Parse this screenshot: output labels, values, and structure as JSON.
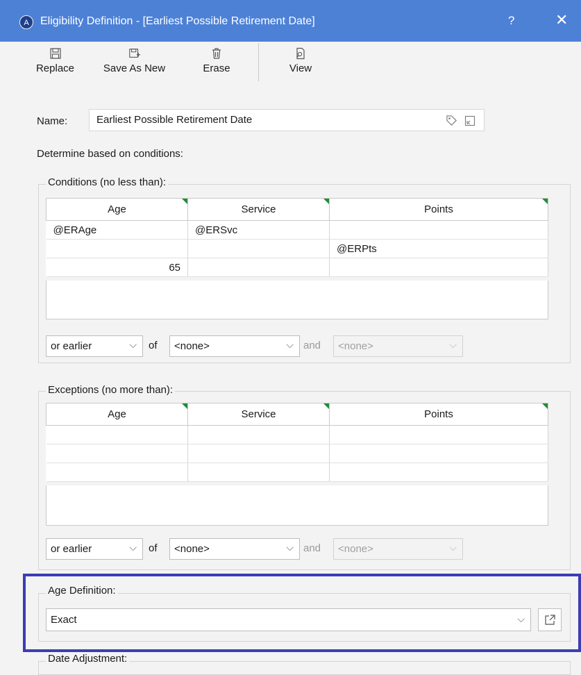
{
  "window": {
    "app_icon_glyph": "A",
    "title": "Eligibility Definition - [Earliest Possible Retirement Date]",
    "help": "?",
    "close": "✕"
  },
  "toolbar": {
    "replace": "Replace",
    "save_as_new": "Save As New",
    "erase": "Erase",
    "view": "View"
  },
  "form": {
    "name_label": "Name:",
    "name_value": "Earliest Possible Retirement Date",
    "determine_label": "Determine based on conditions:"
  },
  "conditions": {
    "title": "Conditions (no less than):",
    "headers": [
      "Age",
      "Service",
      "Points"
    ],
    "rows": [
      [
        "@ERAge",
        "@ERSvc",
        ""
      ],
      [
        "",
        "",
        "@ERPts"
      ],
      [
        "65",
        "",
        ""
      ]
    ],
    "timing_select": "or earlier",
    "of_label": "of",
    "of_select": "<none>",
    "and_label": "and",
    "and_select": "<none>"
  },
  "exceptions": {
    "title": "Exceptions (no more than):",
    "headers": [
      "Age",
      "Service",
      "Points"
    ],
    "rows": [
      [
        "",
        "",
        ""
      ],
      [
        "",
        "",
        ""
      ],
      [
        "",
        "",
        ""
      ]
    ],
    "timing_select": "or earlier",
    "of_label": "of",
    "of_select": "<none>",
    "and_label": "and",
    "and_select": "<none>"
  },
  "age_definition": {
    "title": "Age Definition:",
    "value": "Exact"
  },
  "date_adjustment": {
    "title": "Date Adjustment:"
  },
  "colors": {
    "titlebar": "#4d81d6",
    "highlight": "#3c3db5",
    "header_corner": "#1e8c3a"
  }
}
